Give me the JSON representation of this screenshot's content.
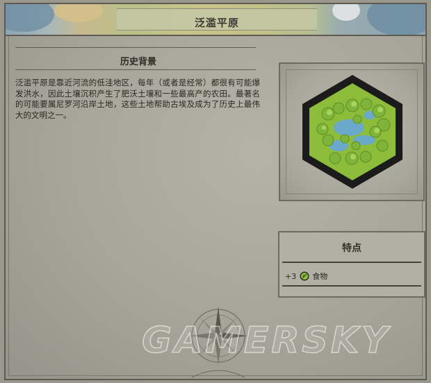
{
  "window": {
    "title": "泛滥平原"
  },
  "history": {
    "heading": "历史背景",
    "body": "泛滥平原是靠近河流的低洼地区，每年（或者是经常）都很有可能爆发洪水，因此土壤沉积产生了肥沃土壤和一些最高产的农田。最著名的可能要属尼罗河沿岸土地，这些土地帮助古埃及成为了历史上最伟大的文明之一。"
  },
  "features": {
    "title": "特点",
    "items": [
      {
        "amount": "+3",
        "icon": "food-icon",
        "label": "食物"
      }
    ]
  },
  "watermark": {
    "text": "GAMERSKY"
  },
  "colors": {
    "parchment": "#a7a499",
    "hex_border": "#1a1a1a",
    "grass": "#8fbf3a",
    "water": "#6aa9c9"
  }
}
